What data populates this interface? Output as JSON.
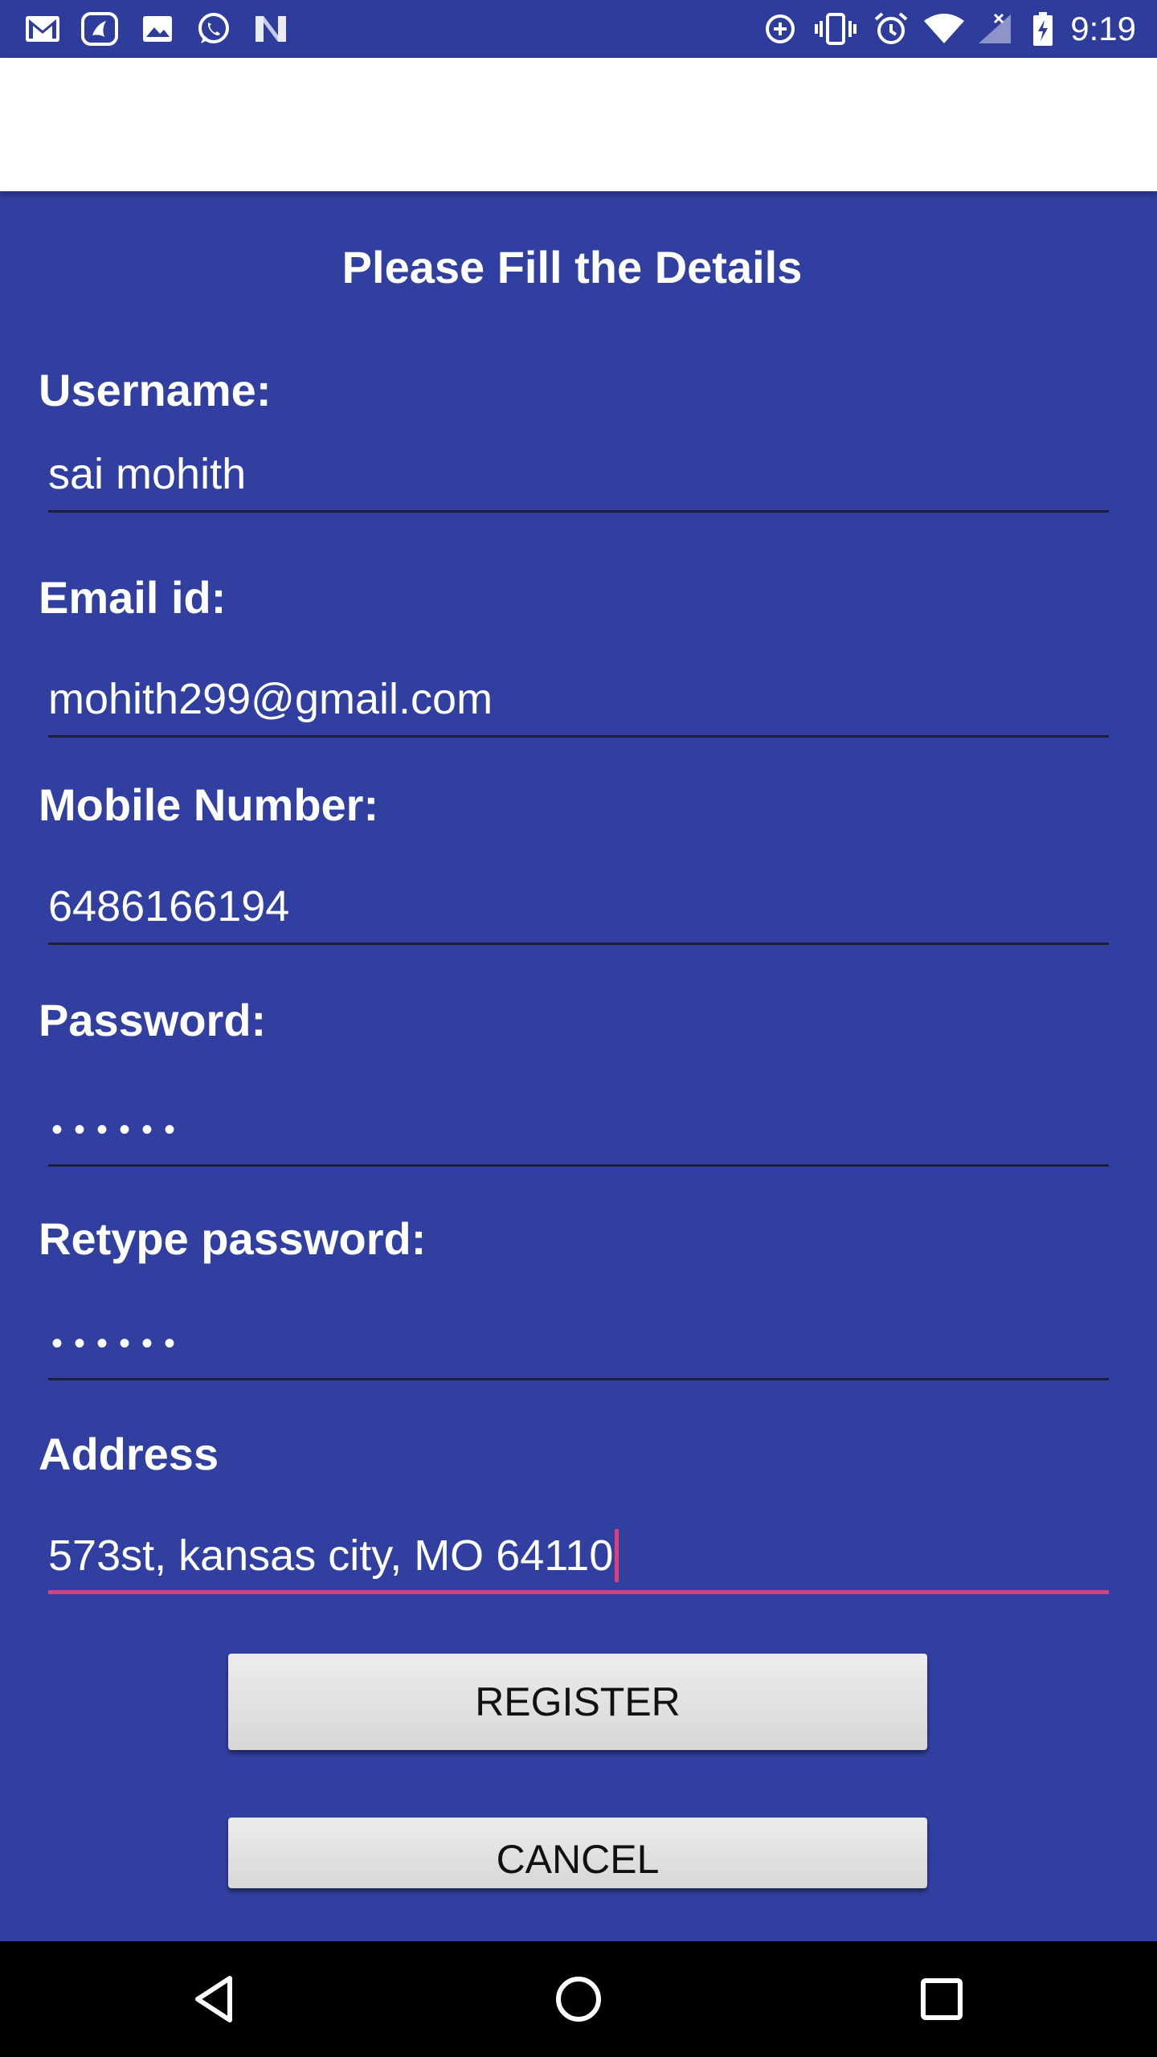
{
  "status_bar": {
    "time": "9:19",
    "left_icons": [
      "gmail-icon",
      "saavn-icon",
      "gallery-icon",
      "whatsapp-icon",
      "n-app-icon"
    ],
    "right_icons": [
      "data-saver-icon",
      "vibrate-icon",
      "alarm-icon",
      "wifi-icon",
      "signal-icon",
      "battery-charging-icon"
    ]
  },
  "form": {
    "title": "Please Fill the Details",
    "username": {
      "label": "Username:",
      "value": "sai mohith"
    },
    "email": {
      "label": "Email id:",
      "value": "mohith299@gmail.com"
    },
    "mobile": {
      "label": "Mobile Number:",
      "value": "6486166194"
    },
    "password": {
      "label": "Password:",
      "value": "••••••"
    },
    "retype_password": {
      "label": "Retype password:",
      "value": "••••••"
    },
    "address": {
      "label": "Address",
      "value": "573st, kansas city, MO 64110"
    },
    "register_label": "REGISTER",
    "cancel_label": "CANCEL"
  },
  "nav_bar": {
    "icons": [
      "back-icon",
      "home-icon",
      "recents-icon"
    ]
  },
  "colors": {
    "status_bar": "#2e3d9b",
    "form_background": "#3140a0",
    "app_bar": "#ffffff",
    "active_underline": "#e0407a",
    "button": "#e0e0e0",
    "nav_bar": "#000000"
  }
}
